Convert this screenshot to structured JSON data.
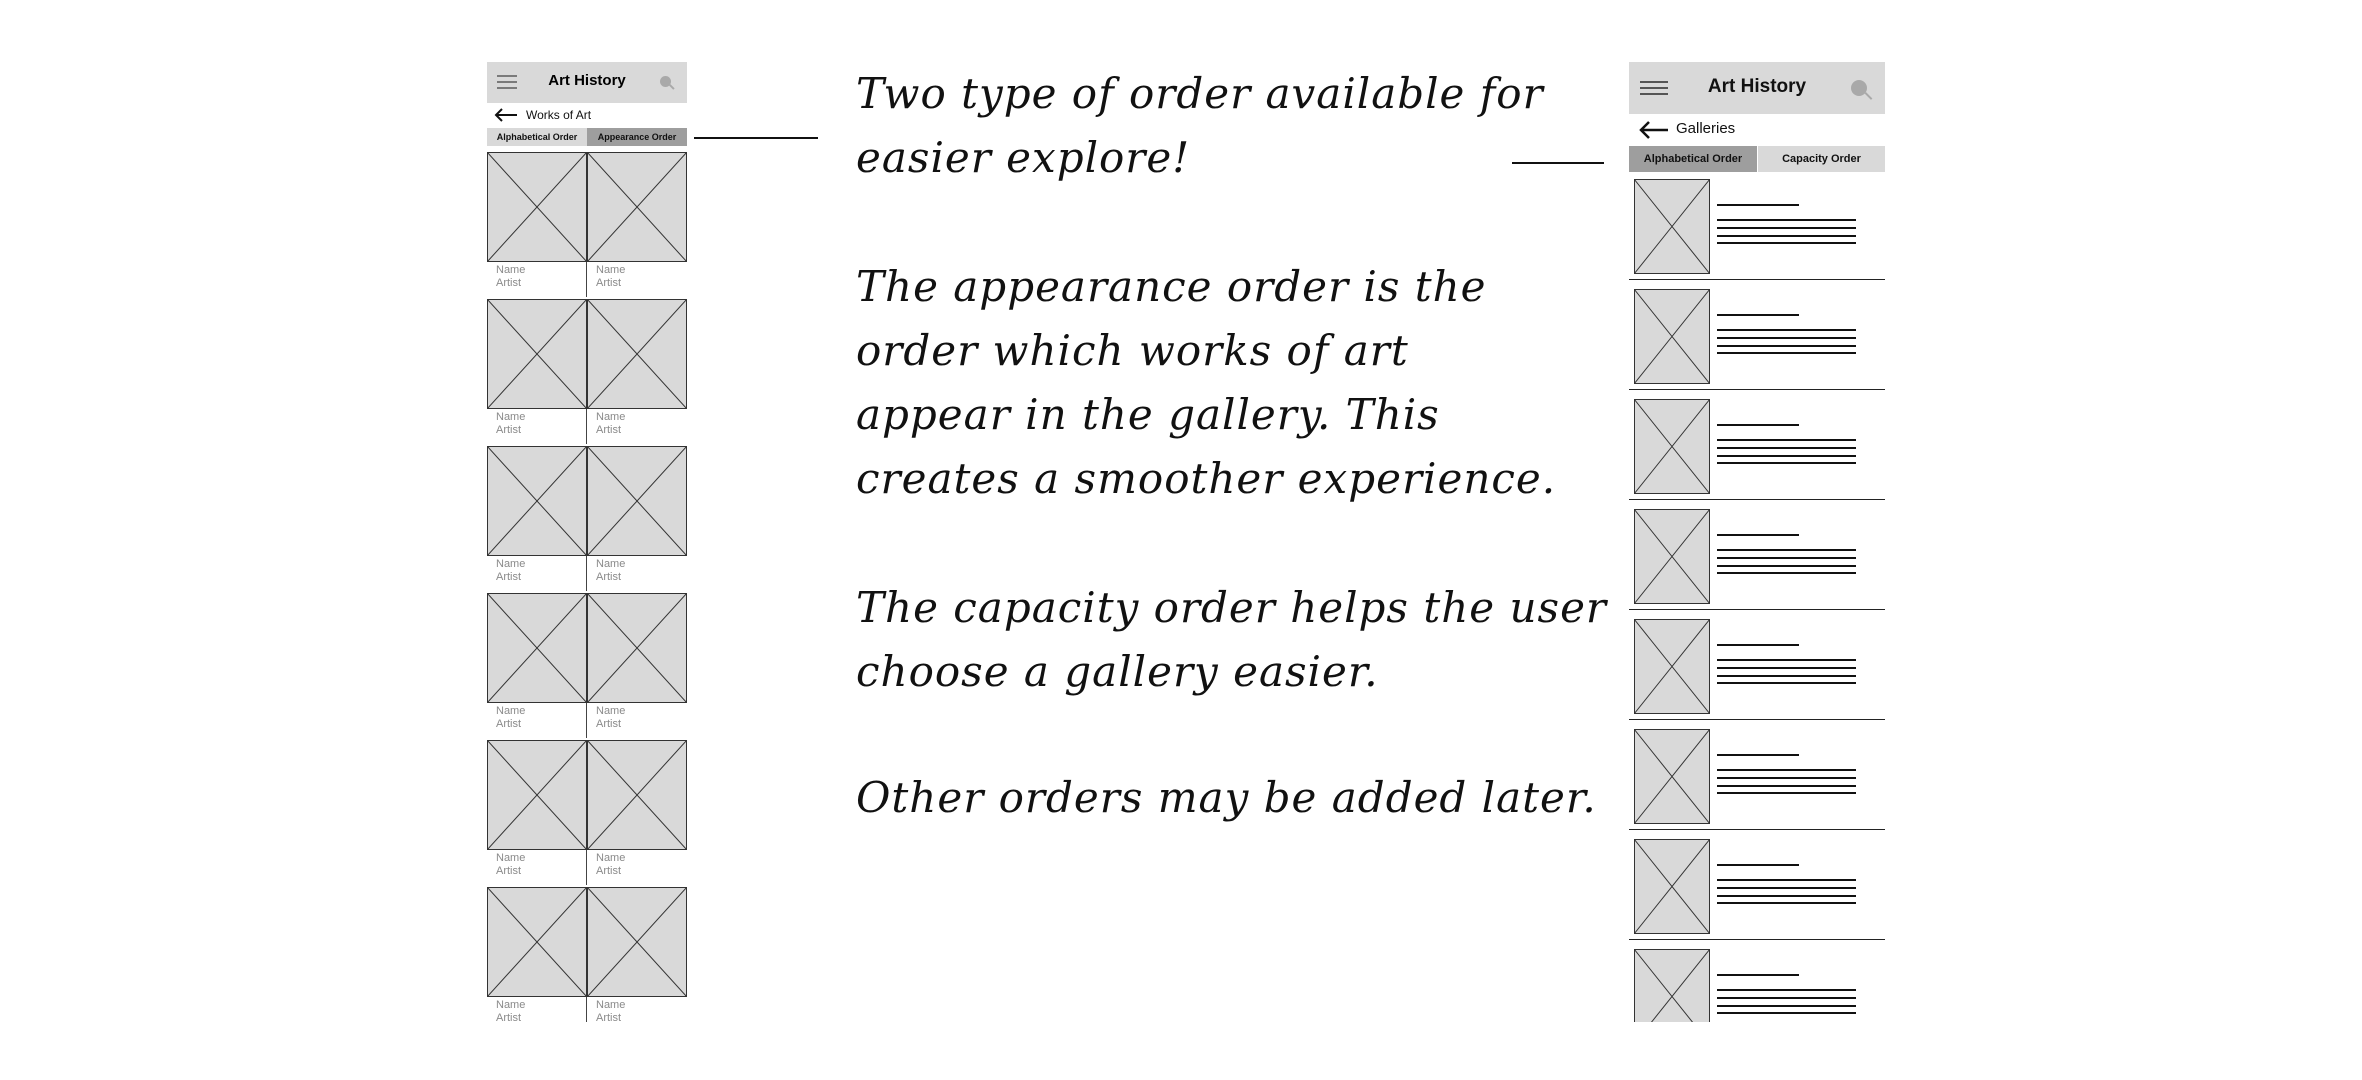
{
  "works_screen": {
    "app_title": "Art History",
    "back_title": "Works of Art",
    "tabs": [
      {
        "label": "Alphabetical Order",
        "active": false
      },
      {
        "label": "Appearance Order",
        "active": true
      }
    ],
    "item_name": "Name",
    "item_artist": "Artist",
    "item_count": 12
  },
  "galleries_screen": {
    "app_title": "Art History",
    "back_title": "Galleries",
    "tabs": [
      {
        "label": "Alphabetical Order",
        "active": true
      },
      {
        "label": "Capacity Order",
        "active": false
      }
    ],
    "item_count": 8
  },
  "notes": [
    "Two type of order available for\neasier explore!",
    "The appearance order is the\norder which works of art\nappear in the gallery. This\ncreates a smoother experience.",
    "The capacity order helps the user\nchoose a gallery easier.",
    "Other orders may be added later."
  ],
  "colors": {
    "placeholder_fill": "#d9d9d9",
    "active_tab": "#9e9e9e",
    "inactive_tab": "#d9d9d9",
    "header_bg": "#d9d9d9"
  }
}
